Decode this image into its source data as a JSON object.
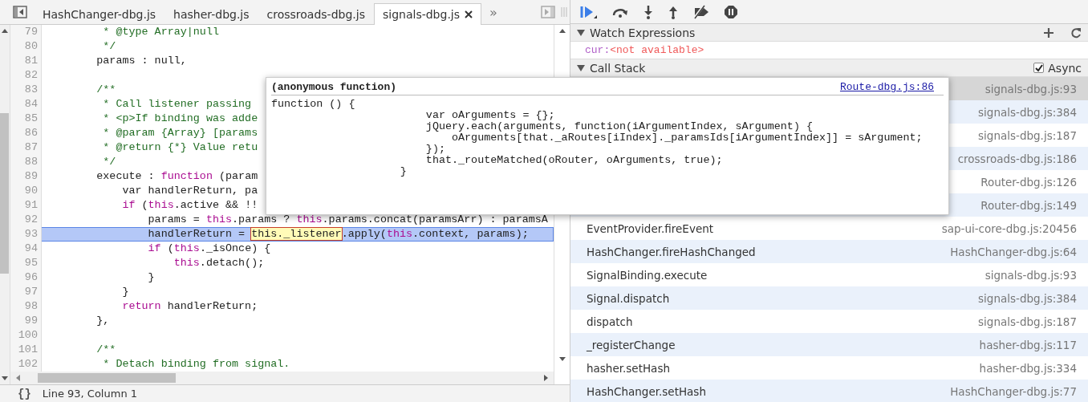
{
  "tabs": [
    {
      "label": "HashChanger-dbg.js",
      "selected": false
    },
    {
      "label": "hasher-dbg.js",
      "selected": false
    },
    {
      "label": "crossroads-dbg.js",
      "selected": false
    },
    {
      "label": "signals-dbg.js",
      "selected": true
    }
  ],
  "overflow_label": "»",
  "editor": {
    "lines": [
      {
        "number": "79",
        "current": false,
        "segments": [
          {
            "text": "         * @type Array|null",
            "kind": "comment"
          }
        ]
      },
      {
        "number": "80",
        "current": false,
        "segments": [
          {
            "text": "         */",
            "kind": "comment"
          }
        ]
      },
      {
        "number": "81",
        "current": false,
        "segments": [
          {
            "text": "        params : null,",
            "kind": "plain"
          }
        ]
      },
      {
        "number": "82",
        "current": false
      },
      {
        "number": "83",
        "current": false,
        "segments": [
          {
            "text": "        /**",
            "kind": "comment"
          }
        ]
      },
      {
        "number": "84",
        "current": false,
        "segments": [
          {
            "text": "         * Call listener passing",
            "kind": "comment"
          }
        ]
      },
      {
        "number": "85",
        "current": false,
        "segments": [
          {
            "text": "         * <p>If binding was adde",
            "kind": "comment"
          }
        ]
      },
      {
        "number": "86",
        "current": false,
        "segments": [
          {
            "text": "         * @param {Array} [params",
            "kind": "comment"
          }
        ]
      },
      {
        "number": "87",
        "current": false,
        "segments": [
          {
            "text": "         * @return {*} Value retu",
            "kind": "comment"
          }
        ]
      },
      {
        "number": "88",
        "current": false,
        "segments": [
          {
            "text": "         */",
            "kind": "comment"
          }
        ]
      },
      {
        "number": "89",
        "current": false,
        "segments": [
          {
            "text": "        execute : ",
            "kind": "plain"
          },
          {
            "text": "function",
            "kind": "keyword"
          },
          {
            "text": " (param",
            "kind": "plain"
          }
        ]
      },
      {
        "number": "90",
        "current": false,
        "segments": [
          {
            "text": "            var handlerReturn, pa",
            "kind": "plain"
          }
        ]
      },
      {
        "number": "91",
        "current": false,
        "segments": [
          {
            "text": "            if",
            "kind": "keyword"
          },
          {
            "text": " (",
            "kind": "plain"
          },
          {
            "text": "this",
            "kind": "keyword"
          },
          {
            "text": ".active && !!",
            "kind": "plain"
          }
        ]
      },
      {
        "number": "92",
        "current": false,
        "segments": [
          {
            "text": "                params = ",
            "kind": "plain"
          },
          {
            "text": "this",
            "kind": "keyword"
          },
          {
            "text": ".params ? ",
            "kind": "plain"
          },
          {
            "text": "this",
            "kind": "keyword"
          },
          {
            "text": ".params.concat(paramsArr) : paramsA",
            "kind": "plain"
          }
        ]
      },
      {
        "number": "93",
        "current": true,
        "segments": [
          {
            "text": "                handlerReturn = ",
            "kind": "plain"
          },
          {
            "text": "this._listener",
            "kind": "hover"
          },
          {
            "text": ".apply(",
            "kind": "plain"
          },
          {
            "text": "this",
            "kind": "keyword"
          },
          {
            "text": ".context, params);",
            "kind": "plain"
          }
        ]
      },
      {
        "number": "94",
        "current": false,
        "segments": [
          {
            "text": "                if",
            "kind": "keyword"
          },
          {
            "text": " (",
            "kind": "plain"
          },
          {
            "text": "this",
            "kind": "keyword"
          },
          {
            "text": "._isOnce) {",
            "kind": "plain"
          }
        ]
      },
      {
        "number": "95",
        "current": false,
        "segments": [
          {
            "text": "                    this",
            "kind": "keyword"
          },
          {
            "text": ".detach();",
            "kind": "plain"
          }
        ]
      },
      {
        "number": "96",
        "current": false,
        "segments": [
          {
            "text": "                }",
            "kind": "plain"
          }
        ]
      },
      {
        "number": "97",
        "current": false,
        "segments": [
          {
            "text": "            }",
            "kind": "plain"
          }
        ]
      },
      {
        "number": "98",
        "current": false,
        "segments": [
          {
            "text": "            return",
            "kind": "keyword"
          },
          {
            "text": " handlerReturn;",
            "kind": "plain"
          }
        ]
      },
      {
        "number": "99",
        "current": false,
        "segments": [
          {
            "text": "        },",
            "kind": "plain"
          }
        ]
      },
      {
        "number": "100",
        "current": false
      },
      {
        "number": "101",
        "current": false,
        "segments": [
          {
            "text": "        /**",
            "kind": "comment"
          }
        ]
      },
      {
        "number": "102",
        "current": false,
        "segments": [
          {
            "text": "         * Detach binding from signal.",
            "kind": "comment"
          }
        ]
      }
    ]
  },
  "status_bar": {
    "format_label": "{}",
    "position": "Line 93, Column 1"
  },
  "popup": {
    "title": "(anonymous function)",
    "link": "Route-dbg.js:86",
    "code": [
      "function () {",
      "                        var oArguments = {};",
      "                        jQuery.each(arguments, function(iArgumentIndex, sArgument) {",
      "                            oArguments[that._aRoutes[iIndex]._paramsIds[iArgumentIndex]] = sArgument;",
      "                        });",
      "                        that._routeMatched(oRouter, oArguments, true);",
      "                    }"
    ]
  },
  "watch": {
    "title": "Watch Expressions",
    "expanded": true,
    "items": [
      {
        "name": "cur:",
        "value": "<not available>"
      }
    ]
  },
  "call_stack": {
    "title": "Call Stack",
    "expanded": true,
    "async_label": "Async",
    "async_checked": true,
    "frames": [
      {
        "location": "signals-dbg.js:93",
        "selected": true
      },
      {
        "location": "signals-dbg.js:384",
        "selected": false
      },
      {
        "location": "signals-dbg.js:187",
        "selected": false
      },
      {
        "location": "crossroads-dbg.js:186",
        "selected": false
      },
      {
        "location": "Router-dbg.js:126",
        "selected": false
      },
      {
        "location": "Router-dbg.js:149",
        "selected": false
      },
      {
        "name": "EventProvider.fireEvent",
        "location": "sap-ui-core-dbg.js:20456",
        "selected": false
      },
      {
        "name": "HashChanger.fireHashChanged",
        "location": "HashChanger-dbg.js:64",
        "selected": false
      },
      {
        "name": "SignalBinding.execute",
        "location": "signals-dbg.js:93",
        "selected": false
      },
      {
        "name": "Signal.dispatch",
        "location": "signals-dbg.js:384",
        "selected": false
      },
      {
        "name": "dispatch",
        "location": "signals-dbg.js:187",
        "selected": false
      },
      {
        "name": "_registerChange",
        "location": "hasher-dbg.js:117",
        "selected": false
      },
      {
        "name": "hasher.setHash",
        "location": "hasher-dbg.js:334",
        "selected": false
      },
      {
        "name": "HashChanger.setHash",
        "location": "HashChanger-dbg.js:77",
        "selected": false
      }
    ]
  }
}
